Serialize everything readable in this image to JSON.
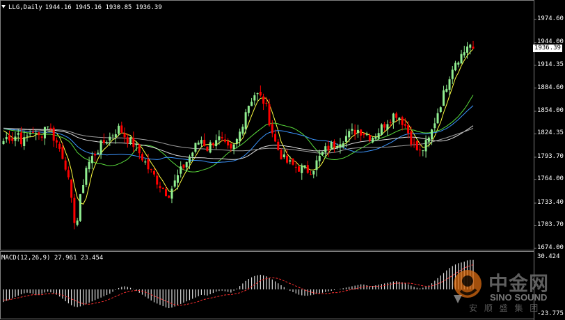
{
  "header": {
    "symbol": "LLG,Daily",
    "ohlc": "1944.16 1945.16 1930.85 1936.39"
  },
  "macd_header": {
    "label": "MACD(12,26,9) 27.961 23.454"
  },
  "price_axis": {
    "labels": [
      "1974.60",
      "1944.00",
      "1914.35",
      "1884.60",
      "1854.00",
      "1824.35",
      "1793.70",
      "1764.00",
      "1733.40",
      "1703.70",
      "1674.00"
    ],
    "current": "1936.39",
    "range": [
      1674,
      1974.6
    ]
  },
  "macd_axis": {
    "labels": [
      "30.424",
      "-23.775"
    ],
    "range": [
      -23.775,
      30.424
    ]
  },
  "colors": {
    "bull": "#ffffff",
    "bullBody": "#000000",
    "bear": "#ff0000",
    "bull_fill": "#90ee90",
    "ma_yellow": "#ffff40",
    "ma_green": "#5adc3c",
    "ma_blue": "#3c96ff",
    "ma_white": "#dcdcdc",
    "ma_gray": "#a0a0a0",
    "signal": "#ff3030"
  },
  "chart_data": {
    "type": "candlestick",
    "close_path": [
      1815,
      1822,
      1818,
      1826,
      1812,
      1822,
      1830,
      1818,
      1826,
      1840,
      1825,
      1812,
      1800,
      1780,
      1735,
      1700,
      1745,
      1780,
      1790,
      1800,
      1808,
      1815,
      1820,
      1828,
      1832,
      1822,
      1815,
      1810,
      1800,
      1790,
      1778,
      1770,
      1760,
      1752,
      1745,
      1756,
      1768,
      1780,
      1790,
      1800,
      1812,
      1818,
      1805,
      1812,
      1820,
      1815,
      1805,
      1800,
      1812,
      1830,
      1855,
      1868,
      1878,
      1872,
      1865,
      1840,
      1815,
      1800,
      1790,
      1785,
      1782,
      1780,
      1778,
      1776,
      1780,
      1790,
      1800,
      1806,
      1810,
      1815,
      1818,
      1822,
      1826,
      1830,
      1828,
      1824,
      1820,
      1825,
      1832,
      1840,
      1846,
      1852,
      1845,
      1835,
      1820,
      1806,
      1800,
      1808,
      1818,
      1840,
      1860,
      1878,
      1900,
      1918,
      1925,
      1930,
      1944,
      1936
    ],
    "macd": [
      -12,
      -10,
      -8,
      -6,
      -4,
      -3,
      -4,
      -6,
      -4,
      -2,
      -3,
      -5,
      -8,
      -12,
      -15,
      -17,
      -16,
      -14,
      -12,
      -10,
      -8,
      -6,
      -4,
      -1,
      2,
      3,
      2,
      0,
      -3,
      -6,
      -9,
      -12,
      -14,
      -16,
      -18,
      -17,
      -15,
      -13,
      -11,
      -9,
      -7,
      -5,
      -6,
      -4,
      -2,
      -1,
      -2,
      -3,
      0,
      4,
      8,
      11,
      13,
      14,
      13,
      11,
      8,
      5,
      2,
      -1,
      -3,
      -5,
      -6,
      -6,
      -5,
      -4,
      -3,
      -2,
      -1,
      0,
      1,
      2,
      3,
      4,
      5,
      4,
      3,
      4,
      5,
      6,
      7,
      8,
      7,
      6,
      4,
      2,
      1,
      2,
      4,
      8,
      12,
      16,
      20,
      23,
      25,
      26,
      28,
      28
    ],
    "signal": [
      -10,
      -10,
      -9,
      -8,
      -7,
      -6,
      -5,
      -5,
      -5,
      -4,
      -4,
      -4,
      -5,
      -7,
      -9,
      -11,
      -13,
      -14,
      -14,
      -13,
      -12,
      -11,
      -9,
      -7,
      -5,
      -3,
      -2,
      -1,
      -1,
      -2,
      -4,
      -6,
      -8,
      -10,
      -12,
      -14,
      -15,
      -15,
      -14,
      -13,
      -12,
      -10,
      -9,
      -8,
      -7,
      -6,
      -5,
      -5,
      -4,
      -3,
      -1,
      2,
      5,
      8,
      10,
      11,
      11,
      10,
      8,
      6,
      4,
      2,
      0,
      -2,
      -3,
      -4,
      -4,
      -4,
      -3,
      -3,
      -2,
      -1,
      0,
      1,
      2,
      3,
      3,
      3,
      3,
      4,
      5,
      6,
      6,
      6,
      6,
      5,
      4,
      3,
      3,
      4,
      6,
      8,
      11,
      14,
      17,
      20,
      22,
      23.5
    ]
  }
}
